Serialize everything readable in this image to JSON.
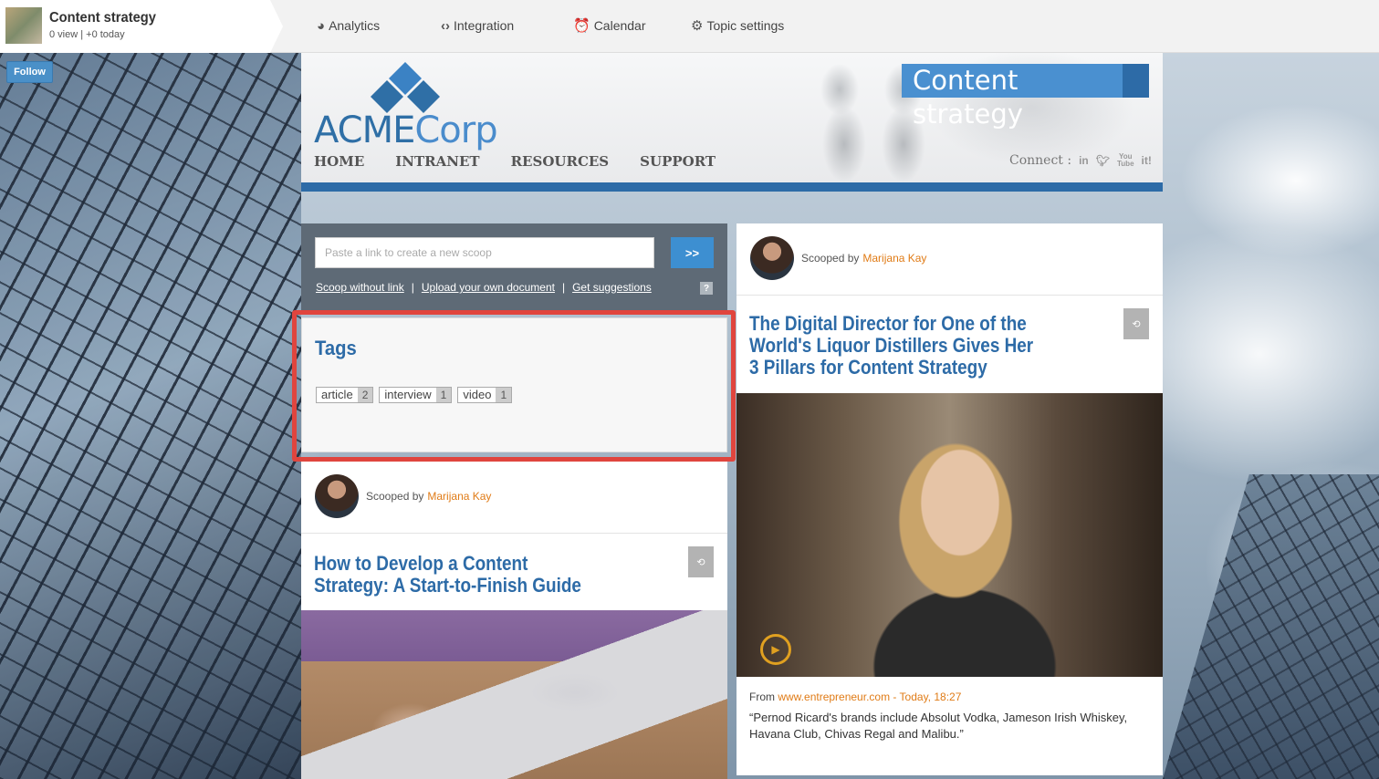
{
  "topbar": {
    "topic_title": "Content strategy",
    "topic_stats": "0 view | +0 today",
    "nav": [
      {
        "label": "Analytics",
        "icon": "pie-chart-icon"
      },
      {
        "label": "Integration",
        "icon": "code-icon"
      },
      {
        "label": "Calendar",
        "icon": "clock-icon"
      },
      {
        "label": "Topic settings",
        "icon": "gears-icon"
      }
    ]
  },
  "follow_label": "Follow",
  "banner": {
    "logo_main": "ACME",
    "logo_accent": "Corp",
    "nav": [
      "HOME",
      "INTRANET",
      "RESOURCES",
      "SUPPORT"
    ],
    "brand_title": "Content strategy",
    "connect_label": "Connect :",
    "social": [
      "in",
      "twitter",
      "You Tube",
      "it!"
    ],
    "accent_color": "#2d6ba7"
  },
  "scoop": {
    "placeholder": "Paste a link to create a new scoop",
    "go_label": ">>",
    "links": [
      "Scoop without link",
      "Upload your own document",
      "Get suggestions"
    ],
    "separator": "|",
    "help": "?"
  },
  "tags": {
    "title": "Tags",
    "items": [
      {
        "label": "article",
        "count": "2"
      },
      {
        "label": "interview",
        "count": "1"
      },
      {
        "label": "video",
        "count": "1"
      }
    ]
  },
  "posts": [
    {
      "scooped_by_label": "Scooped by",
      "author": "Marijana Kay",
      "title_line1": "How to Develop a Content",
      "title_line2": "Strategy: A Start-to-Finish Guide"
    },
    {
      "scooped_by_label": "Scooped by",
      "author": "Marijana Kay",
      "title_line1": "The Digital Director for One of the",
      "title_line2": "World's Liquor Distillers Gives Her",
      "title_line3": "3 Pillars for Content Strategy",
      "from_label": "From",
      "source": "www.entrepreneur.com",
      "time": "Today, 18:27",
      "quote": "“Pernod Ricard's brands include Absolut Vodka, Jameson Irish Whiskey, Havana Club, Chivas Regal and Malibu.”"
    }
  ]
}
